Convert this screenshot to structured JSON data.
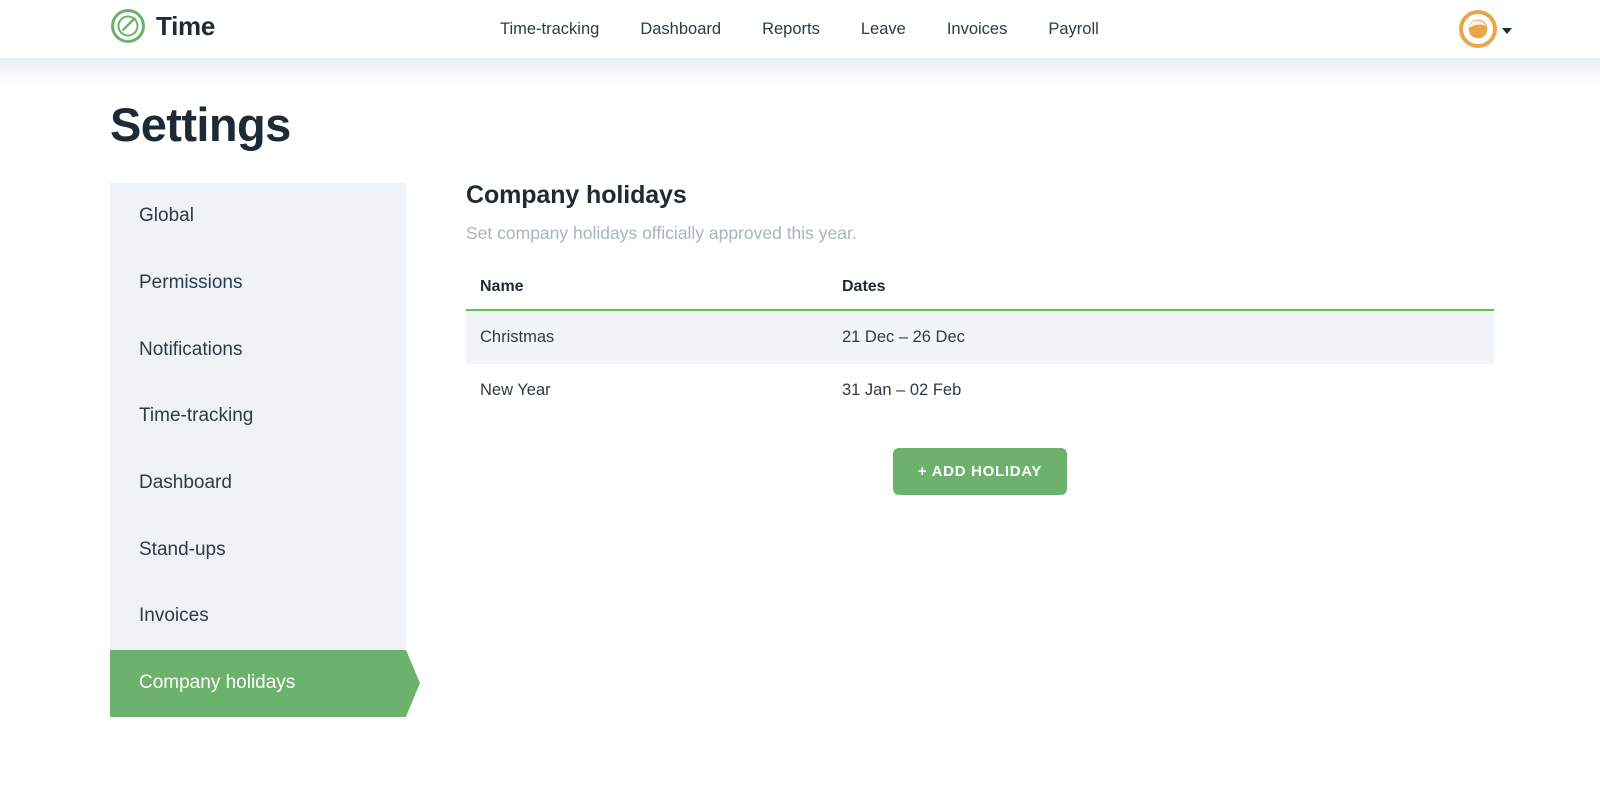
{
  "brand": {
    "name": "Time",
    "logo_icon": "time-logo-icon"
  },
  "header": {
    "nav": [
      {
        "label": "Time-tracking"
      },
      {
        "label": "Dashboard"
      },
      {
        "label": "Reports"
      },
      {
        "label": "Leave"
      },
      {
        "label": "Invoices"
      },
      {
        "label": "Payroll"
      }
    ],
    "account": {
      "avatar_icon": "user-avatar-icon",
      "caret_icon": "chevron-down-icon"
    }
  },
  "page": {
    "title": "Settings"
  },
  "settings_nav": {
    "items": [
      {
        "label": "Global",
        "active": false
      },
      {
        "label": "Permissions",
        "active": false
      },
      {
        "label": "Notifications",
        "active": false
      },
      {
        "label": "Time-tracking",
        "active": false
      },
      {
        "label": "Dashboard",
        "active": false
      },
      {
        "label": "Stand-ups",
        "active": false
      },
      {
        "label": "Invoices",
        "active": false
      },
      {
        "label": "Company holidays",
        "active": true
      }
    ]
  },
  "panel": {
    "title": "Company holidays",
    "subtitle": "Set company holidays officially approved this year.",
    "table": {
      "columns": [
        "Name",
        "Dates"
      ],
      "rows": [
        {
          "name": "Christmas",
          "dates": "21 Dec – 26 Dec"
        },
        {
          "name": "New Year",
          "dates": "31 Jan – 02 Feb"
        }
      ]
    },
    "add_button_label": "+ ADD HOLIDAY"
  },
  "colors": {
    "accent_green": "#6cb26c",
    "table_rule_green": "#63bb52",
    "sidebar_bg": "#eff3f6",
    "row_shaded_bg": "#f1f5f8",
    "text_dark": "#1d2b36",
    "text_muted": "#a7b4c0",
    "avatar_orange": "#e8a54a"
  }
}
